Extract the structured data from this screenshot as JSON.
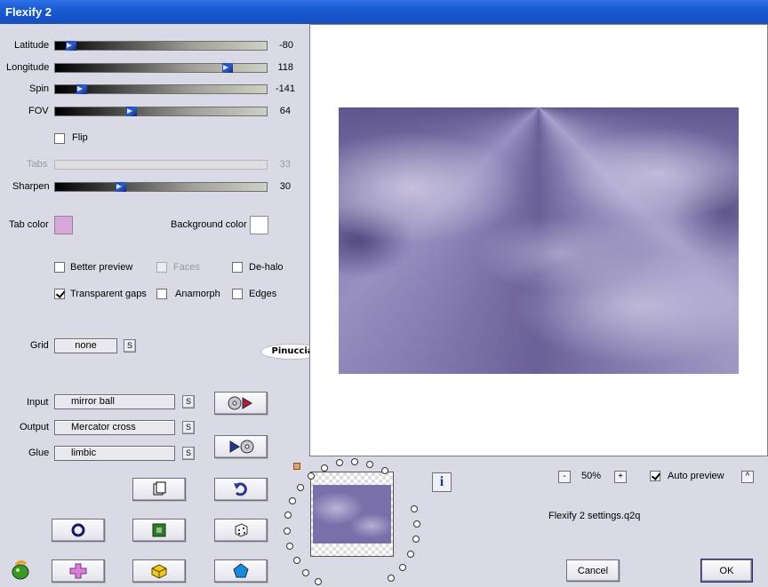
{
  "window": {
    "title": "Flexify 2"
  },
  "sliders": [
    {
      "label": "Latitude",
      "value": "-80",
      "fraction": 0.08
    },
    {
      "label": "Longitude",
      "value": "118",
      "fraction": 0.83
    },
    {
      "label": "Spin",
      "value": "-141",
      "fraction": 0.11
    },
    {
      "label": "FOV",
      "value": "64",
      "fraction": 0.36
    }
  ],
  "flip": {
    "label": "Flip",
    "checked": false
  },
  "tabs": {
    "label": "Tabs",
    "value": "33",
    "enabled": false
  },
  "sharpen": {
    "label": "Sharpen",
    "value": "30",
    "fraction": 0.3
  },
  "colors": {
    "tab_color_label": "Tab color",
    "tab_color": "#d8a8dc",
    "background_color_label": "Background color",
    "background_color": "#ffffff"
  },
  "options": {
    "better_preview": "Better preview",
    "faces": "Faces",
    "de_halo": "De-halo",
    "transparent_gaps": "Transparent gaps",
    "anamorph": "Anamorph",
    "edges": "Edges"
  },
  "grid": {
    "label": "Grid",
    "value": "none",
    "s": "S"
  },
  "mapping": {
    "input_label": "Input",
    "input_value": "mirror ball",
    "output_label": "Output",
    "output_value": "Mercator cross",
    "glue_label": "Glue",
    "glue_value": "limbic",
    "s": "S"
  },
  "watermark": "Pinuccia",
  "info_label": "i",
  "zoom": {
    "minus": "-",
    "value": "50%",
    "plus": "+"
  },
  "auto_preview": {
    "label": "Auto preview",
    "checked": true,
    "collapse": "^"
  },
  "settings_file": "Flexify 2 settings.q2q",
  "buttons": {
    "cancel": "Cancel",
    "ok": "OK"
  }
}
